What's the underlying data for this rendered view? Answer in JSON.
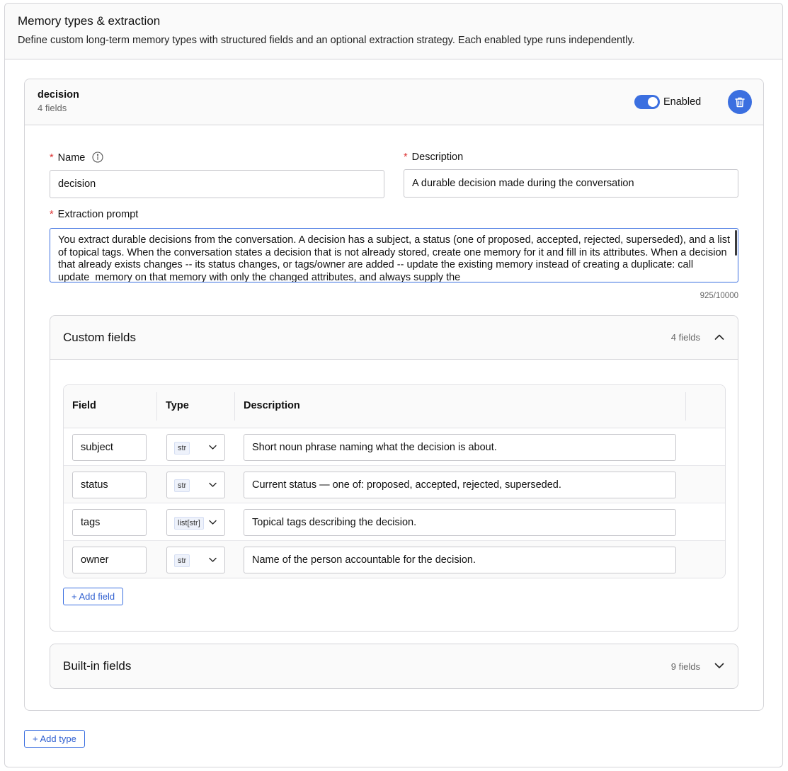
{
  "panel": {
    "title": "Memory types & extraction",
    "description": "Define custom long-term memory types with structured fields and an optional extraction strategy. Each enabled type runs independently."
  },
  "type": {
    "name": "decision",
    "field_count": "4 fields",
    "enabled_label": "Enabled",
    "enabled": true
  },
  "form": {
    "name_label": "Name",
    "name_value": "decision",
    "description_label": "Description",
    "description_value": "A durable decision made during the conversation",
    "prompt_label": "Extraction prompt",
    "prompt_value": "You extract durable decisions from the conversation. A decision has a subject, a status (one of proposed, accepted, rejected, superseded), and a list of topical tags. When the conversation states a decision that is not already stored, create one memory for it and fill in its attributes. When a decision that already exists changes -- its status changes, or tags/owner are added -- update the existing memory instead of creating a duplicate: call update_memory on that memory with only the changed attributes, and always supply the",
    "char_count": "925/10000",
    "required_mark": "*"
  },
  "custom_fields": {
    "title": "Custom fields",
    "count": "4 fields",
    "columns": [
      "Field",
      "Type",
      "Description"
    ],
    "rows": [
      {
        "field": "subject",
        "type": "str",
        "description": "Short noun phrase naming what the decision is about."
      },
      {
        "field": "status",
        "type": "str",
        "description": "Current status — one of: proposed, accepted, rejected, superseded."
      },
      {
        "field": "tags",
        "type": "list[str]",
        "description": "Topical tags describing the decision."
      },
      {
        "field": "owner",
        "type": "str",
        "description": "Name of the person accountable for the decision."
      }
    ],
    "add_label": "+ Add field"
  },
  "builtin_fields": {
    "title": "Built-in fields",
    "count": "9 fields"
  },
  "add_type_label": "+ Add type",
  "colors": {
    "accent": "#3b6fe0",
    "required": "#dd3333",
    "border": "#d4d4d8"
  }
}
